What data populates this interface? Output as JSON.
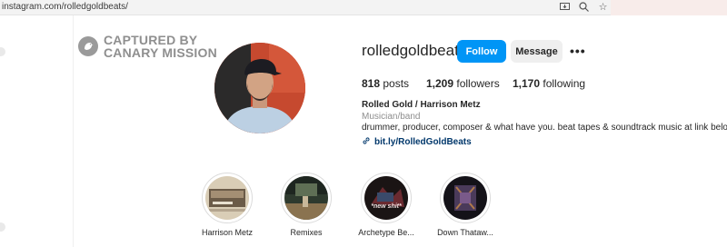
{
  "browser": {
    "url": "instagram.com/rolledgoldbeats/",
    "icons": [
      "install-app-icon",
      "zoom-icon",
      "bookmark-star-icon"
    ]
  },
  "watermark": {
    "line1": "CAPTURED BY",
    "line2": "CANARY MISSION"
  },
  "profile": {
    "username": "rolledgoldbeats",
    "follow_label": "Follow",
    "message_label": "Message",
    "more_label": "•••",
    "stats": {
      "posts_count": "818",
      "posts_label": "posts",
      "followers_count": "1,209",
      "followers_label": "followers",
      "following_count": "1,170",
      "following_label": "following"
    },
    "name": "Rolled Gold / Harrison Metz",
    "category": "Musician/band",
    "bio": "drummer, producer, composer & what have you. beat tapes & soundtrack music at link below",
    "bio_arrow": "⬇",
    "link": "bit.ly/RolledGoldBeats"
  },
  "highlights": [
    {
      "label": "Harrison Metz",
      "cover_text": ""
    },
    {
      "label": "Remixes",
      "cover_text": ""
    },
    {
      "label": "Archetype Be...",
      "cover_text": "*new shit*"
    },
    {
      "label": "Down Thataw...",
      "cover_text": ""
    }
  ],
  "colors": {
    "accent": "#0095f6",
    "link": "#00376b",
    "muted": "#8e8e8e"
  }
}
